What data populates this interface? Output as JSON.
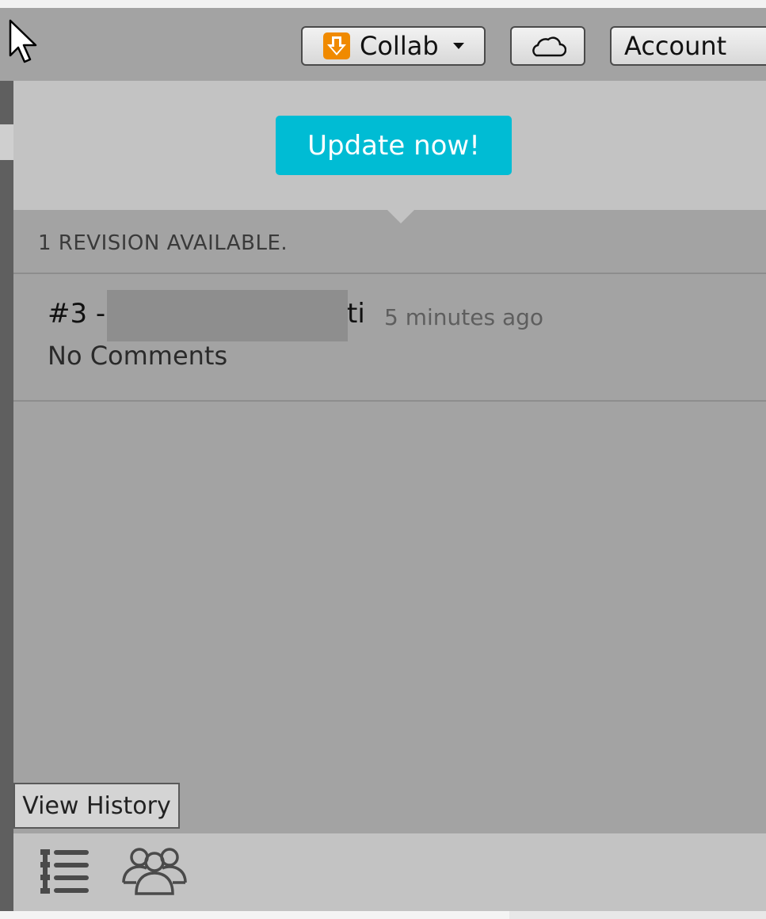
{
  "toolbar": {
    "collab_label": "Collab",
    "account_label": "Account"
  },
  "panel": {
    "update_button": "Update now!",
    "revisions_header": "1 REVISION AVAILABLE.",
    "revision": {
      "number": "#3 -",
      "author_suffix": "ti",
      "time": "5 minutes ago",
      "comment": "No Comments"
    }
  },
  "footer": {
    "view_history": "View History"
  },
  "icons": [
    "cursor-icon",
    "collab-download-icon",
    "caret-down-icon",
    "cloud-icon",
    "list-icon",
    "group-icon"
  ],
  "colors": {
    "accent": "#00bcd4",
    "collab_icon": "#f08a00",
    "panel_bg": "#a3a3a3",
    "header_bg": "#c3c3c3"
  }
}
